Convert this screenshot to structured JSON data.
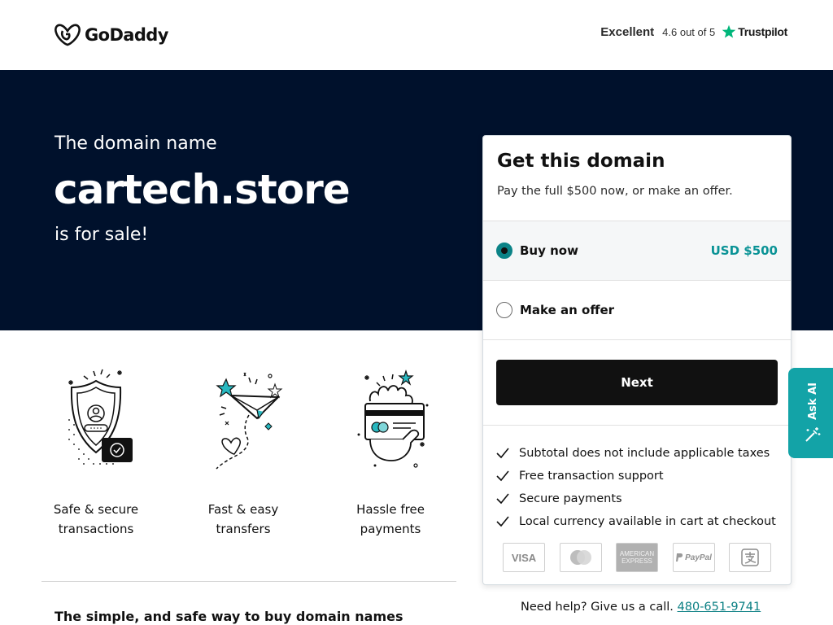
{
  "header": {
    "brand": "GoDaddy",
    "trust_rating_word": "Excellent",
    "trust_score": "4.6 out of 5",
    "trust_brand": "Trustpilot"
  },
  "hero": {
    "intro": "The domain name",
    "domain": "cartech.store",
    "outro": "is for sale!"
  },
  "features": [
    {
      "line1": "Safe & secure",
      "line2": "transactions",
      "icon": "shield-icon"
    },
    {
      "line1": "Fast & easy",
      "line2": "transfers",
      "icon": "paper-plane-icon"
    },
    {
      "line1": "Hassle free",
      "line2": "payments",
      "icon": "card-hand-icon"
    }
  ],
  "bottom_title": "The simple, and safe way to buy domain names",
  "card": {
    "title": "Get this domain",
    "subtitle": "Pay the full $500 now, or make an offer.",
    "options": [
      {
        "label": "Buy now",
        "price": "USD $500",
        "selected": true
      },
      {
        "label": "Make an offer",
        "price": "",
        "selected": false
      }
    ],
    "next_label": "Next",
    "benefits": [
      "Subtotal does not include applicable taxes",
      "Free transaction support",
      "Secure payments",
      "Local currency available in cart at checkout"
    ],
    "payment_methods": [
      "VISA",
      "Mastercard",
      "American Express",
      "PayPal",
      "Alipay"
    ],
    "payment_labels": {
      "visa": "VISA",
      "amex_1": "AMERICAN",
      "amex_2": "EXPRESS",
      "paypal": "PayPal"
    }
  },
  "help": {
    "text": "Need help? Give us a call.",
    "phone": "480-651-9741"
  },
  "ask_ai": {
    "label": "Ask AI"
  },
  "colors": {
    "hero_bg": "#00112c",
    "accent": "#0a9396",
    "button_bg": "#111111",
    "ask_ai_bg": "#13a3a7"
  }
}
